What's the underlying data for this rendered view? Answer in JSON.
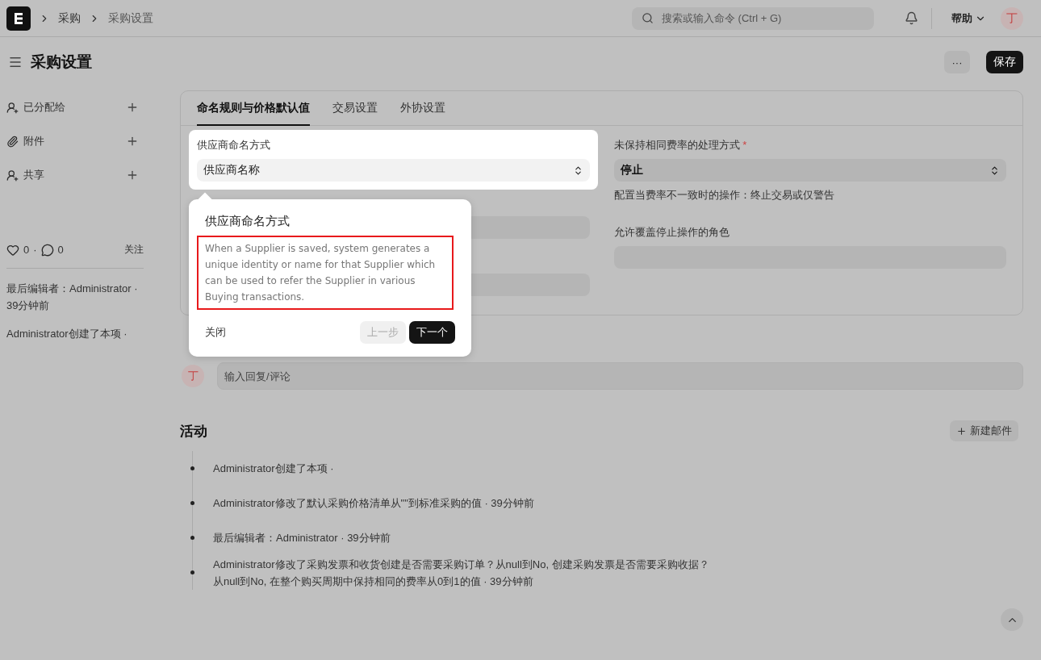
{
  "topbar": {
    "breadcrumbs": [
      "采购",
      "采购设置"
    ],
    "search": {
      "placeholder": "搜索或输入命令 (Ctrl + G)"
    },
    "help": "帮助",
    "avatar": "丁"
  },
  "page": {
    "title": "采购设置",
    "more": "···",
    "save": "保存"
  },
  "sidebar": {
    "items": [
      {
        "label": "已分配给",
        "kind": "assign"
      },
      {
        "label": "附件",
        "kind": "attach"
      },
      {
        "label": "共享",
        "kind": "share"
      }
    ],
    "likes": "0",
    "separator": "·",
    "comments": "0",
    "follow": "关注",
    "last_edited": "最后编辑者：Administrator · 39分钟前",
    "created": "Administrator创建了本项 ·"
  },
  "tabs": [
    {
      "label": "命名规则与价格默认值",
      "selected": true
    },
    {
      "label": "交易设置",
      "selected": false
    },
    {
      "label": "外协设置",
      "selected": false
    }
  ],
  "form": {
    "left": [
      {
        "kind": "select",
        "label": "供应商命名方式",
        "value": "供应商名称",
        "highlighted": true
      },
      {
        "kind": "input",
        "highlighted": false
      },
      {
        "kind": "input",
        "highlighted": false
      }
    ],
    "right": [
      {
        "kind": "select",
        "label": "未保持相同费率的处理方式",
        "required_mark": "*",
        "value": "停止",
        "description": "配置当费率不一致时的操作：终止交易或仅警告",
        "highlighted": false
      },
      {
        "kind": "input",
        "label": "允许覆盖停止操作的角色",
        "highlighted": false
      }
    ]
  },
  "tour": {
    "title": "供应商命名方式",
    "body": "When a Supplier is saved, system generates a unique identity or name for that Supplier which can be used to refer the Supplier in various Buying transactions.",
    "close": "关闭",
    "prev": {
      "label": "上一步",
      "disabled": true
    },
    "next": "下一个"
  },
  "comment": {
    "avatar": "丁",
    "placeholder": "输入回复/评论"
  },
  "activity": {
    "title": "活动",
    "new_email": "新建邮件",
    "items": [
      {
        "lines": [
          "Administrator创建了本项 ·"
        ]
      },
      {
        "lines": [
          "Administrator修改了默认采购价格清单从\"\"到标准采购的值 · 39分钟前"
        ]
      },
      {
        "lines": [
          "最后编辑者：Administrator · 39分钟前"
        ]
      },
      {
        "lines": [
          "Administrator修改了采购发票和收货创建是否需要采购订单？从null到No, 创建采购发票是否需要采购收据？",
          "从null到No, 在整个购买周期中保持相同的费率从0到1的值 · 39分钟前"
        ]
      }
    ]
  }
}
